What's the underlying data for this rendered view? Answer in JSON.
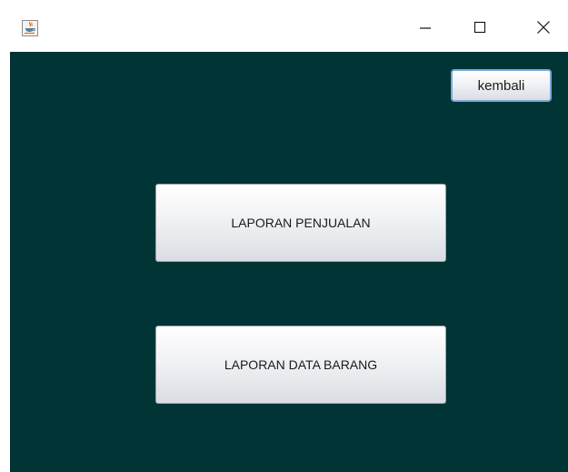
{
  "window": {
    "icon": "java-cup-icon",
    "controls": {
      "minimize_icon": "minimize-icon",
      "maximize_icon": "maximize-icon",
      "close_icon": "close-icon"
    }
  },
  "colors": {
    "content_background": "#003435",
    "button_face": "#f1f2f5",
    "focus_border": "#7aa8d6"
  },
  "toolbar": {
    "back_label": "kembali"
  },
  "menu": {
    "sales_report_label": "LAPORAN PENJUALAN",
    "goods_report_label": "LAPORAN DATA BARANG"
  }
}
